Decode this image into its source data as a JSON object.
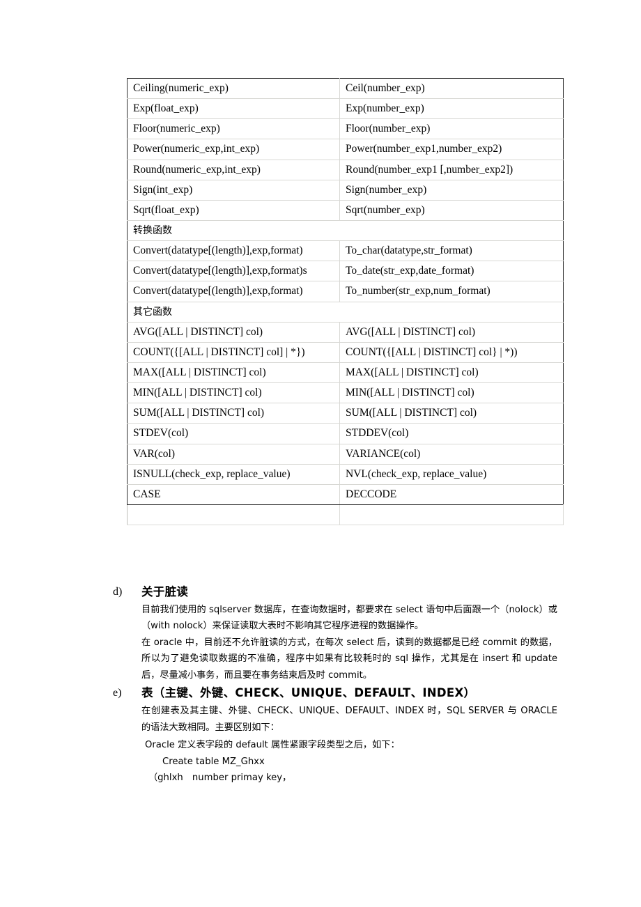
{
  "document": {
    "table": {
      "caption_none": "",
      "rows": [
        {
          "kind": "pair",
          "left": "Ceiling(numeric_exp)",
          "right": "Ceil(number_exp)"
        },
        {
          "kind": "pair",
          "left": "Exp(float_exp)",
          "right": "Exp(number_exp)"
        },
        {
          "kind": "pair",
          "left": "Floor(numeric_exp)",
          "right": "Floor(number_exp)"
        },
        {
          "kind": "pair",
          "left": "Power(numeric_exp,int_exp)",
          "right": "Power(number_exp1,number_exp2)"
        },
        {
          "kind": "pair",
          "left": "Round(numeric_exp,int_exp)",
          "right": "Round(number_exp1 [,number_exp2])"
        },
        {
          "kind": "pair",
          "left": "Sign(int_exp)",
          "right": "Sign(number_exp)"
        },
        {
          "kind": "pair",
          "left": "Sqrt(float_exp)",
          "right": "Sqrt(number_exp)"
        },
        {
          "kind": "section",
          "label": "转换函数"
        },
        {
          "kind": "convert",
          "left": "Convert(datatype[(length)],exp,format)",
          "right": "To_char(datatype,str_format)"
        },
        {
          "kind": "convert",
          "left": "Convert(datatype[(length)],exp,format)s",
          "right": "To_date(str_exp,date_format)"
        },
        {
          "kind": "convert",
          "left": "Convert(datatype[(length)],exp,format)",
          "right": "To_number(str_exp,num_format)"
        },
        {
          "kind": "section",
          "label": "其它函数"
        },
        {
          "kind": "pair",
          "left": "AVG([ALL | DISTINCT] col)",
          "right": "AVG([ALL | DISTINCT] col)"
        },
        {
          "kind": "pair",
          "left": "COUNT({[ALL | DISTINCT] col] | *})",
          "right": "COUNT({[ALL | DISTINCT] col} | *))"
        },
        {
          "kind": "pair",
          "left": "MAX([ALL | DISTINCT] col)",
          "right": "MAX([ALL | DISTINCT] col)"
        },
        {
          "kind": "pair",
          "left": "MIN([ALL | DISTINCT] col)",
          "right": "MIN([ALL | DISTINCT] col)"
        },
        {
          "kind": "pair",
          "left": "SUM([ALL | DISTINCT] col)",
          "right": "SUM([ALL | DISTINCT] col)"
        },
        {
          "kind": "pair",
          "left": "STDEV(col)",
          "right": "STDDEV(col)"
        },
        {
          "kind": "pair",
          "left": "VAR(col)",
          "right": "VARIANCE(col)"
        },
        {
          "kind": "pair",
          "left": "ISNULL(check_exp, replace_value)",
          "right": "NVL(check_exp, replace_value)"
        },
        {
          "kind": "pair",
          "left": "CASE",
          "right": "DECCODE"
        },
        {
          "kind": "empty",
          "left": "",
          "mid": "",
          "right": ""
        }
      ]
    },
    "clauses": [
      {
        "marker": "d)",
        "title": "关于脏读",
        "paragraphs": [
          "目前我们使用的 sqlserver 数据库，在查询数据时，都要求在 select 语句中后面跟一个（nolock）或（with nolock）来保证读取大表时不影响其它程序进程的数据操作。",
          "在 oracle 中，目前还不允许脏读的方式，在每次 select 后，读到的数据都是已经 commit 的数据，所以为了避免读取数据的不准确，程序中如果有比较耗时的 sql 操作，尤其是在 insert 和 update 后，尽量减小事务，而且要在事务结束后及时 commit。"
        ]
      },
      {
        "marker": "e)",
        "title": "表（主键、外键、CHECK、UNIQUE、DEFAULT、INDEX）",
        "paragraphs": [
          "在创建表及其主键、外键、CHECK、UNIQUE、DEFAULT、INDEX 时，SQL SERVER 与 ORACLE 的语法大致相同。主要区别如下："
        ],
        "sub_note": "Oracle 定义表字段的 default 属性紧跟字段类型之后，如下：",
        "code_lines": [
          "Create table MZ_Ghxx",
          "（ghlxh　number primay key，"
        ]
      }
    ]
  }
}
